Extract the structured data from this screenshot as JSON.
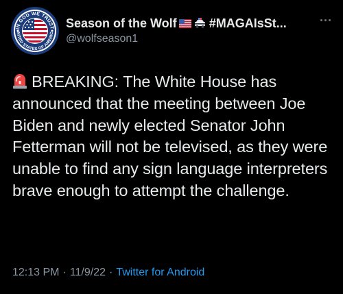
{
  "author": {
    "display_name": "Season of the Wolf",
    "name_tail": "#MAGAIsSt...",
    "handle": "@wolfseason1",
    "avatar_text": [
      "IN GOD WE TRUST",
      "UNITED STATES OF AMERICA"
    ]
  },
  "tweet": {
    "text": "BREAKING: The White House has announced that the meeting between Joe Biden and newly elected Senator John Fetterman will not be televised, as they were unable to find any sign language interpreters brave enough to attempt the challenge.",
    "time": "12:13 PM",
    "date": "11/9/22",
    "separator": "·",
    "source": "Twitter for Android"
  },
  "icons": {
    "flag": "us-flag-emoji",
    "car": "police-car-emoji",
    "siren": "police-siren-emoji",
    "more": "more-options-icon"
  },
  "colors": {
    "background": "#000000",
    "text": "#e7e9ea",
    "secondary": "#8b98a5",
    "link": "#1d9bf0"
  }
}
